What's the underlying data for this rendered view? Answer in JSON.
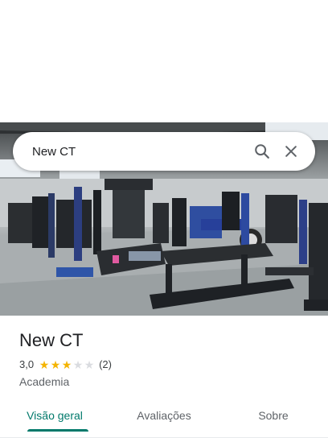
{
  "search": {
    "value": "New CT",
    "search_icon": "search-icon",
    "clear_icon": "close-icon"
  },
  "place": {
    "name": "New CT",
    "rating": "3,0",
    "stars": 3,
    "stars_max": 5,
    "review_count": "(2)",
    "category": "Academia"
  },
  "tabs": [
    {
      "label": "Visão geral",
      "active": true
    },
    {
      "label": "Avaliações",
      "active": false
    },
    {
      "label": "Sobre",
      "active": false
    }
  ],
  "colors": {
    "accent": "#00796b",
    "star": "#f4b400",
    "star_empty": "#dadce0"
  }
}
